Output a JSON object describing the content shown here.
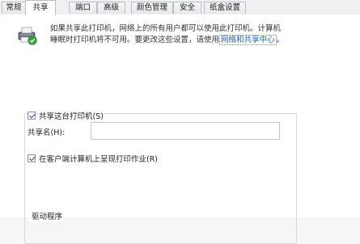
{
  "tabs": [
    {
      "label": "常规",
      "active": false
    },
    {
      "label": "共享",
      "active": true
    },
    {
      "label": "端口",
      "active": false
    },
    {
      "label": "高级",
      "active": false
    },
    {
      "label": "颜色管理",
      "active": false
    },
    {
      "label": "安全",
      "active": false
    },
    {
      "label": "纸盒设置",
      "active": false
    }
  ],
  "description": {
    "line1": "如果共享此打印机，网络上的所有用户都可以使用此打印机。计算机",
    "line2_prefix": "睡眠时打印机将不可用。要更改这些设置，请使用",
    "link_text": "网络和共享中心",
    "line2_suffix": "。"
  },
  "share_printer": {
    "label": "共享这台打印机(S)",
    "checked": true
  },
  "share_name": {
    "label": "共享名(H):",
    "value": ""
  },
  "render_on_client": {
    "label": "在客户端计算机上呈现打印作业(R)",
    "checked": true
  },
  "drivers_group": {
    "label": "驱动程序"
  },
  "icons": {
    "printer": "printer-share-icon"
  },
  "colors": {
    "link": "#1e5fb4",
    "check": "#2a4a8a",
    "shield_green": "#3aa63a"
  }
}
